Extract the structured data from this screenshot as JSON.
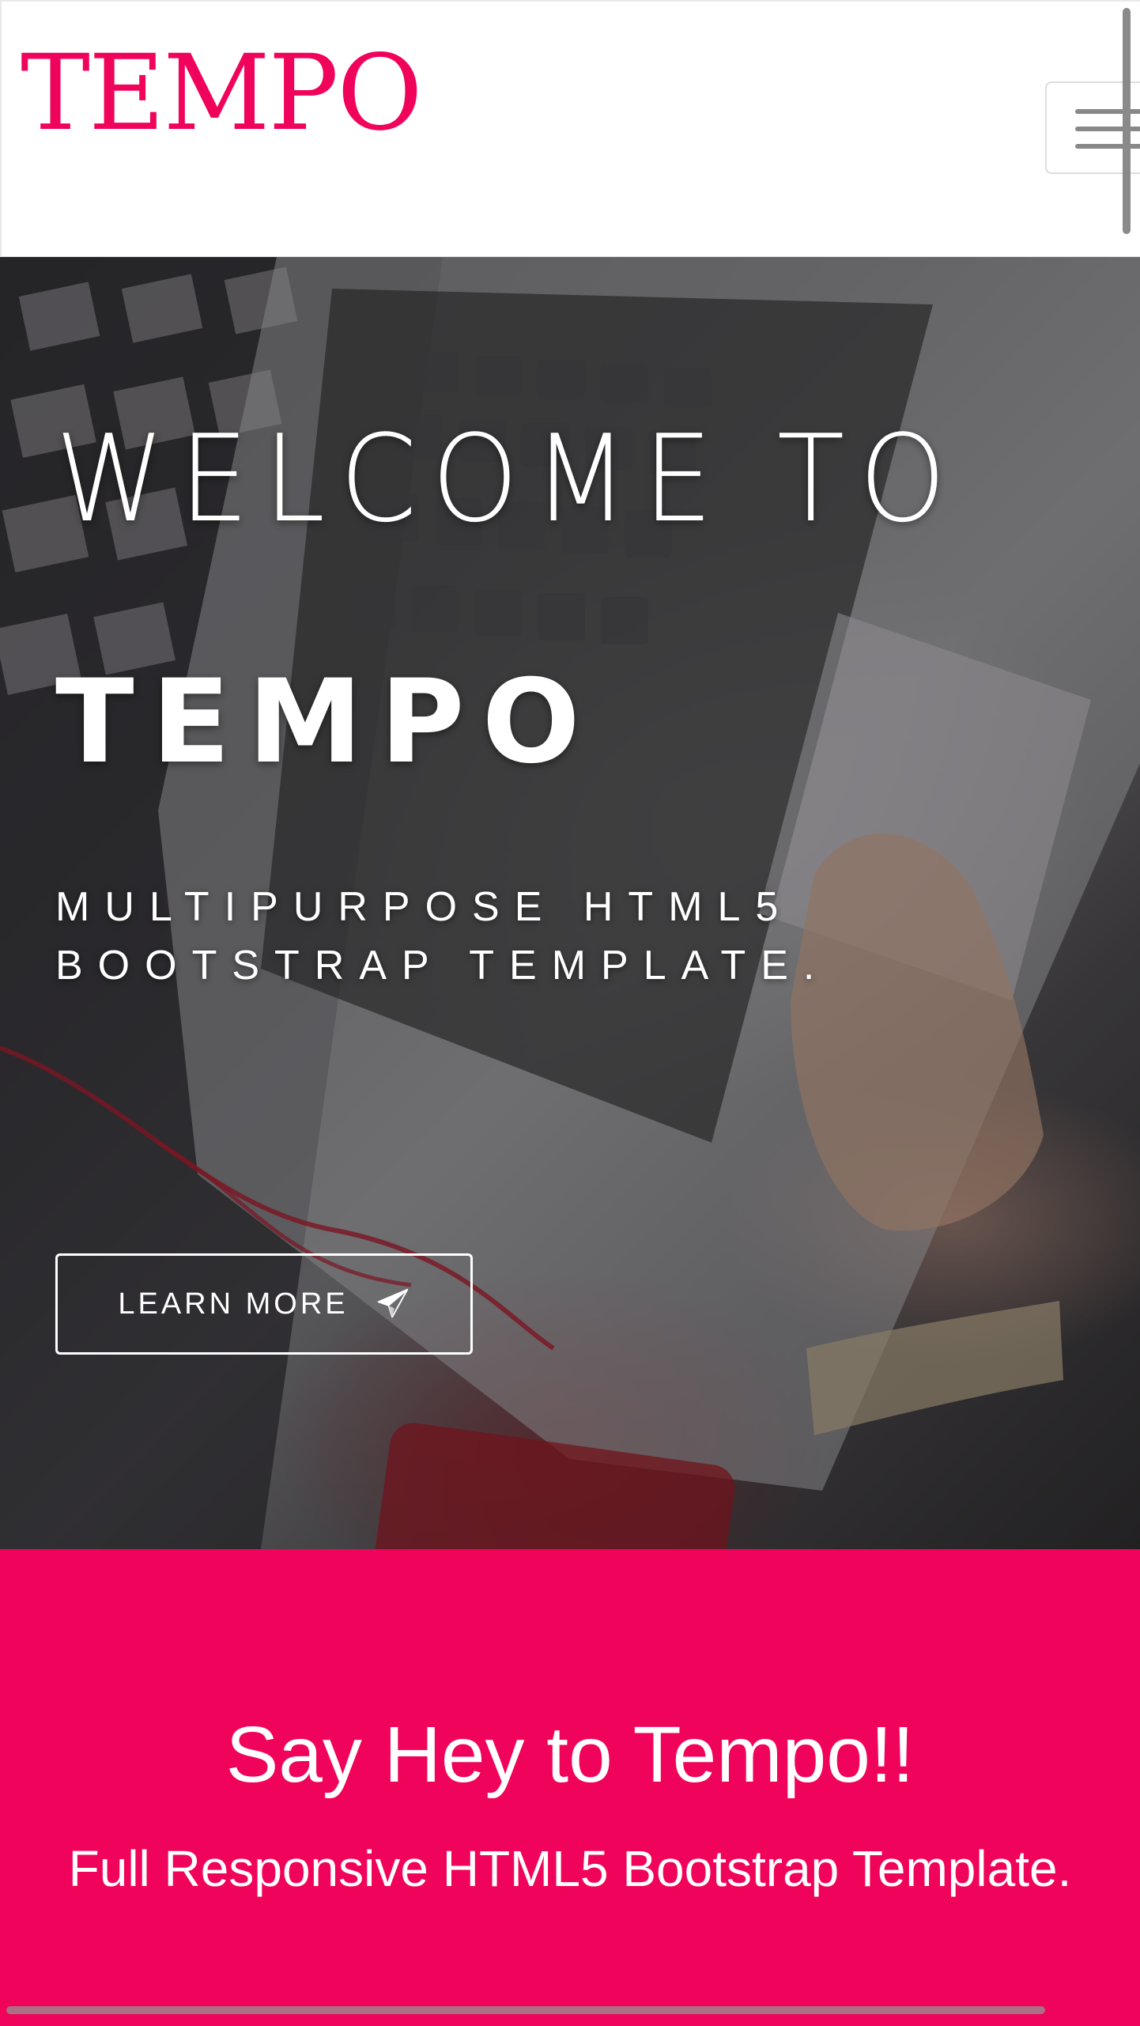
{
  "navbar": {
    "brand": "TEMPO",
    "menu_toggle_icon": "hamburger-menu-icon"
  },
  "hero": {
    "welcome": "WELCOME TO",
    "brand": "TEMPO",
    "tagline": "MULTIPURPOSE HTML5 BOOTSTRAP TEMPLATE.",
    "cta_label": "LEARN MORE",
    "cta_icon": "paper-plane-icon"
  },
  "intro": {
    "title": "Say Hey to Tempo!!",
    "subtitle": "Full Responsive HTML5 Bootstrap Template."
  },
  "colors": {
    "accent": "#f0035a",
    "navbar_bg": "#ffffff",
    "text_on_dark": "#ffffff"
  }
}
